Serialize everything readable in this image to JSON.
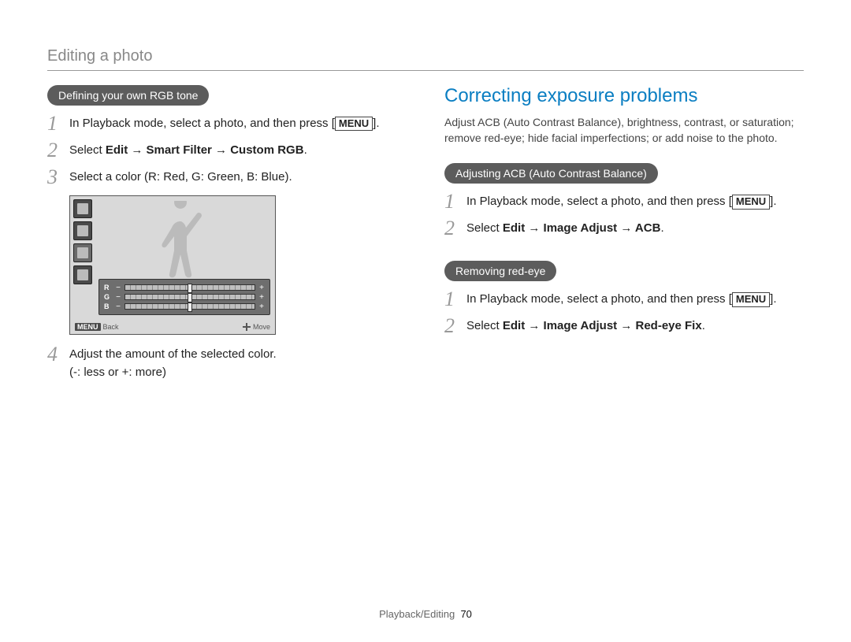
{
  "header": {
    "title": "Editing a photo"
  },
  "left": {
    "pill": "Defining your own RGB tone",
    "steps": [
      {
        "n": "1",
        "text_before": "In Playback mode, select a photo, and then press [",
        "menu": "MENU",
        "text_after": "]."
      },
      {
        "n": "2",
        "prefix": "Select ",
        "bold": "Edit → Smart Filter → Custom RGB",
        "suffix": "."
      },
      {
        "n": "3",
        "text": "Select a color (R: Red, G: Green, B: Blue)."
      },
      {
        "n": "4",
        "text": "Adjust the amount of the selected color.",
        "sub": "(-: less or +: more)"
      }
    ],
    "screen": {
      "sliders": [
        "R",
        "G",
        "B"
      ],
      "footer_menu": "MENU",
      "footer_back": "Back",
      "footer_move": "Move"
    }
  },
  "right": {
    "heading": "Correcting exposure problems",
    "intro": "Adjust ACB (Auto Contrast Balance), brightness, contrast, or saturation; remove red-eye; hide facial imperfections; or add noise to the photo.",
    "sections": [
      {
        "pill": "Adjusting ACB (Auto Contrast Balance)",
        "steps": [
          {
            "n": "1",
            "text_before": "In Playback mode, select a photo, and then press [",
            "menu": "MENU",
            "text_after": "]."
          },
          {
            "n": "2",
            "prefix": "Select ",
            "bold": "Edit → Image Adjust → ACB",
            "suffix": "."
          }
        ]
      },
      {
        "pill": "Removing red-eye",
        "steps": [
          {
            "n": "1",
            "text_before": "In Playback mode, select a photo, and then press [",
            "menu": "MENU",
            "text_after": "]."
          },
          {
            "n": "2",
            "prefix": "Select ",
            "bold": "Edit → Image Adjust → Red-eye Fix",
            "suffix": "."
          }
        ]
      }
    ]
  },
  "footer": {
    "section": "Playback/Editing",
    "page": "70"
  }
}
